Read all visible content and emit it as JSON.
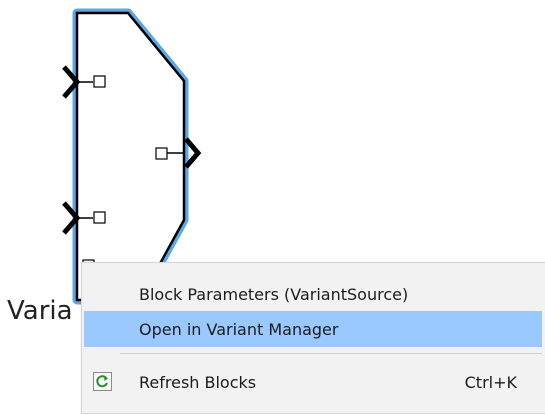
{
  "canvas": {
    "block": {
      "name": "Variant Source block",
      "label": "Varia"
    }
  },
  "context_menu": {
    "items": [
      {
        "label": "Block Parameters (VariantSource)",
        "shortcut": "",
        "icon": ""
      },
      {
        "label": "Open in Variant Manager",
        "shortcut": "",
        "icon": "",
        "highlighted": true
      },
      {
        "label": "Refresh Blocks",
        "shortcut": "Ctrl+K",
        "icon": "refresh-icon"
      }
    ]
  },
  "colors": {
    "selection_outline": "#5aa9e6",
    "menu_highlight": "#99c9ff",
    "menu_background": "#f2f2f2",
    "refresh_icon_green": "#2e8b2e"
  }
}
